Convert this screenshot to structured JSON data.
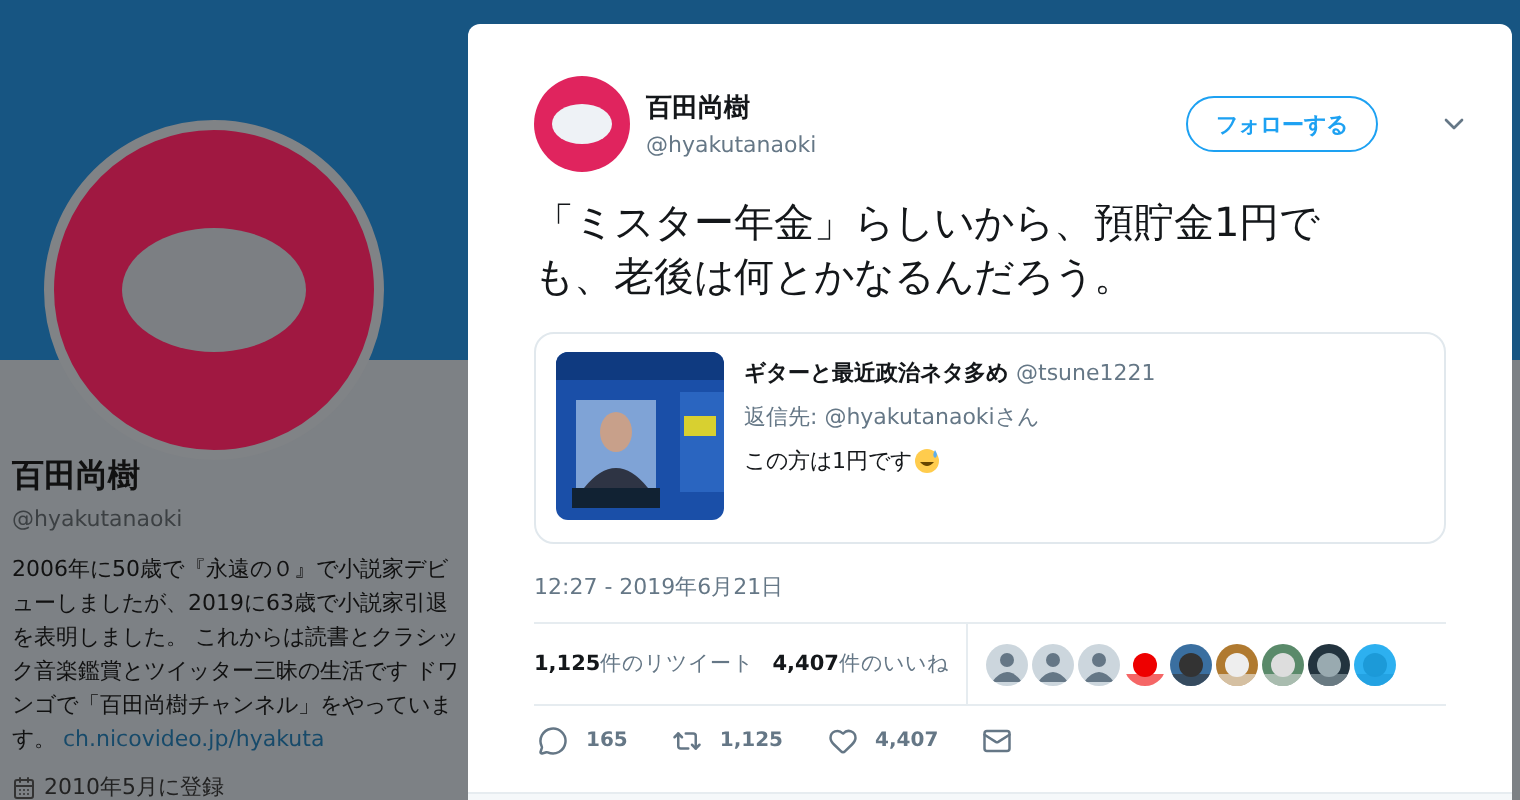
{
  "profile": {
    "name": "百田尚樹",
    "handle": "@hyakutanaoki",
    "bio": "2006年に50歳で『永遠の０』で小説家デビューしましたが、2019に63歳で小説家引退を表明しました。 これからは読書とクラシック音楽鑑賞とツイッター三昧の生活です ドワンゴで「百田尚樹チャンネル」をやっています。",
    "link": "ch.nicovideo.jp/hyakuta",
    "joined": "2010年5月に登録"
  },
  "tweet": {
    "name": "百田尚樹",
    "handle": "@hyakutanaoki",
    "follow_button": "フォローする",
    "text": "「ミスター年金」らしいから、預貯金1円でも、老後は何とかなるんだろう。",
    "quote": {
      "name": "ギターと最近政治ネタ多め",
      "handle": "@tsune1221",
      "reply_to": "返信先: @hyakutanaokiさん",
      "text": "この方は1円です"
    },
    "timestamp": "12:27 - 2019年6月21日",
    "stats": [
      "**1,125**件のリツイート",
      "**4,407**件のいいね"
    ],
    "likers": [
      {
        "kind": "default"
      },
      {
        "kind": "default"
      },
      {
        "kind": "default"
      },
      {
        "kind": "picture"
      },
      {
        "kind": "picture"
      },
      {
        "kind": "picture"
      },
      {
        "kind": "picture"
      },
      {
        "kind": "picture"
      },
      {
        "kind": "picture"
      }
    ],
    "actions": [
      {
        "kind": "reply",
        "count": "165"
      },
      {
        "kind": "retweet",
        "count": "1,125"
      },
      {
        "kind": "like",
        "count": "4,407"
      },
      {
        "kind": "message"
      }
    ]
  }
}
